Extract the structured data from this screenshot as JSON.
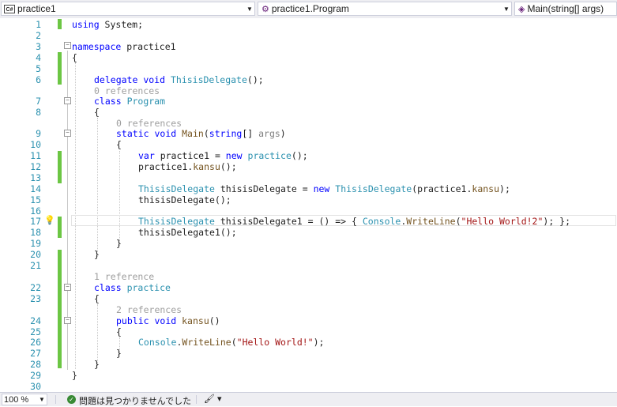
{
  "navbar": {
    "project": "practice1",
    "project_icon": "csharp-project-icon",
    "class": "practice1.Program",
    "class_icon": "class-icon",
    "member": "Main(string[] args)",
    "member_icon": "method-icon"
  },
  "editor": {
    "line_numbers": [
      "1",
      "2",
      "3",
      "4",
      "5",
      "6",
      "7",
      "8",
      "9",
      "10",
      "11",
      "12",
      "13",
      "14",
      "15",
      "16",
      "17",
      "18",
      "19",
      "20",
      "21",
      "22",
      "23",
      "24",
      "25",
      "26",
      "27",
      "28",
      "29",
      "30"
    ],
    "refs": {
      "program": "0 references",
      "main": "0 references",
      "practice_class": "1 reference",
      "kansu": "2 references"
    },
    "code": {
      "l1_kw": "using",
      "l1_rest": " System;",
      "l3_kw": "namespace",
      "l3_rest": " practice1",
      "l4": "{",
      "l6_kw1": "delegate",
      "l6_kw2": "void",
      "l6_ty": "ThisisDelegate",
      "l6_rest": "();",
      "l7_kw": "class",
      "l7_ty": "Program",
      "l8": "{",
      "l9_kw1": "static",
      "l9_kw2": "void",
      "l9_fn": "Main",
      "l9_p1": "(",
      "l9_kw3": "string",
      "l9_p2": "[] ",
      "l9_arg": "args",
      "l9_p3": ")",
      "l10": "{",
      "l11_kw": "var",
      "l11_a": " practice1 = ",
      "l11_kw2": "new",
      "l11_ty": "practice",
      "l11_b": "();",
      "l12_a": "practice1.",
      "l12_fn": "kansu",
      "l12_b": "();",
      "l14_ty": "ThisisDelegate",
      "l14_a": " thisisDelegate = ",
      "l14_kw": "new",
      "l14_ty2": "ThisisDelegate",
      "l14_b": "(practice1.",
      "l14_fn": "kansu",
      "l14_c": ");",
      "l15_a": "thisisDelegate();",
      "l17_ty": "ThisisDelegate",
      "l17_a": " thisisDelegate1 = () => { ",
      "l17_ty2": "Console",
      "l17_b": ".",
      "l17_fn": "WriteLine",
      "l17_c": "(",
      "l17_st": "\"Hello World!2\"",
      "l17_d": "); };",
      "l18_a": "thisisDelegate1();",
      "l19": "}",
      "l20": "}",
      "l22_kw": "class",
      "l22_ty": "practice",
      "l23": "{",
      "l24_kw1": "public",
      "l24_kw2": "void",
      "l24_fn": "kansu",
      "l24_a": "()",
      "l25": "{",
      "l26_ty": "Console",
      "l26_a": ".",
      "l26_fn": "WriteLine",
      "l26_b": "(",
      "l26_st": "\"Hello World!\"",
      "l26_c": ");",
      "l27": "}",
      "l28": "}",
      "l29": "}"
    }
  },
  "statusbar": {
    "zoom": "100 %",
    "issues": "問題は見つかりませんでした",
    "status_color": "#388a34"
  }
}
